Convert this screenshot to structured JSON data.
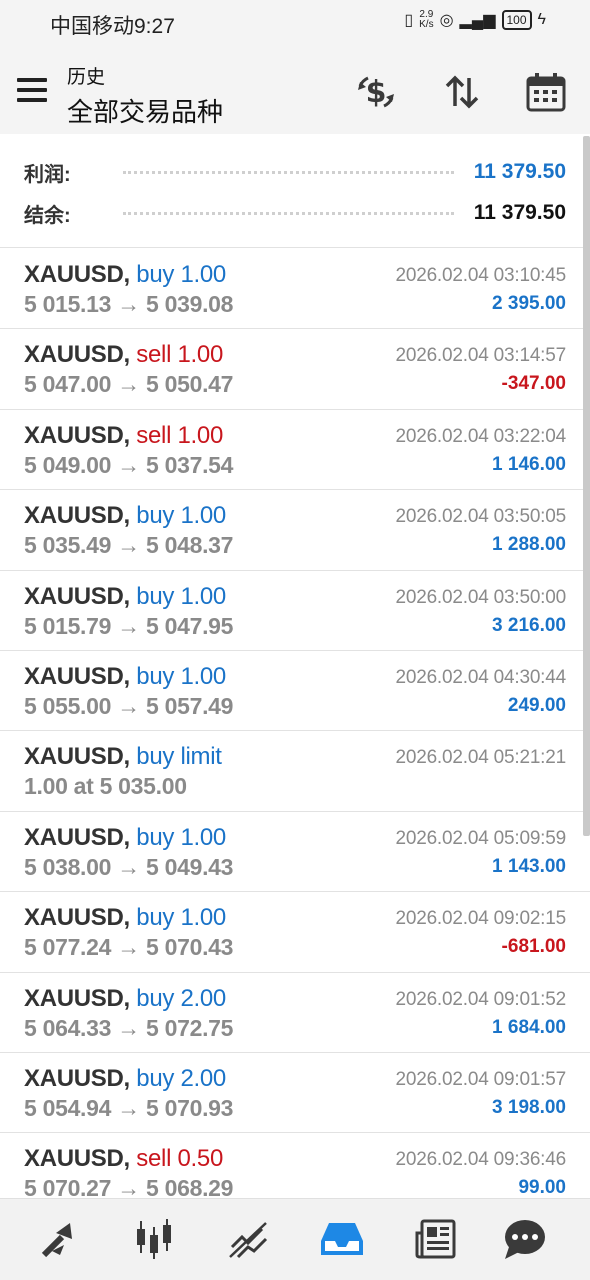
{
  "status_bar": {
    "carrier_time": "中国移动9:27",
    "speed_value": "2.9",
    "speed_unit": "K/s",
    "battery": "100"
  },
  "app_bar": {
    "subtitle": "历史",
    "title": "全部交易品种"
  },
  "summary": {
    "profit_label": "利润:",
    "profit_value": "11 379.50",
    "balance_label": "结余:",
    "balance_value": "11 379.50"
  },
  "trades": [
    {
      "symbol": "XAUUSD,",
      "type": "buy 1.00",
      "side": "buy",
      "prices": "5 015.13 → 5 039.08",
      "time": "2026.02.04 03:10:45",
      "profit": "2 395.00",
      "sign": "pos"
    },
    {
      "symbol": "XAUUSD,",
      "type": "sell 1.00",
      "side": "sell",
      "prices": "5 047.00 → 5 050.47",
      "time": "2026.02.04 03:14:57",
      "profit": "-347.00",
      "sign": "neg"
    },
    {
      "symbol": "XAUUSD,",
      "type": "sell 1.00",
      "side": "sell",
      "prices": "5 049.00 → 5 037.54",
      "time": "2026.02.04 03:22:04",
      "profit": "1 146.00",
      "sign": "pos"
    },
    {
      "symbol": "XAUUSD,",
      "type": "buy 1.00",
      "side": "buy",
      "prices": "5 035.49 → 5 048.37",
      "time": "2026.02.04 03:50:05",
      "profit": "1 288.00",
      "sign": "pos"
    },
    {
      "symbol": "XAUUSD,",
      "type": "buy 1.00",
      "side": "buy",
      "prices": "5 015.79 → 5 047.95",
      "time": "2026.02.04 03:50:00",
      "profit": "3 216.00",
      "sign": "pos"
    },
    {
      "symbol": "XAUUSD,",
      "type": "buy 1.00",
      "side": "buy",
      "prices": "5 055.00 → 5 057.49",
      "time": "2026.02.04 04:30:44",
      "profit": "249.00",
      "sign": "pos"
    },
    {
      "symbol": "XAUUSD,",
      "type": "buy limit",
      "side": "buy",
      "prices": "1.00 at 5 035.00",
      "time": "2026.02.04 05:21:21",
      "profit": "",
      "sign": "pos"
    },
    {
      "symbol": "XAUUSD,",
      "type": "buy 1.00",
      "side": "buy",
      "prices": "5 038.00 → 5 049.43",
      "time": "2026.02.04 05:09:59",
      "profit": "1 143.00",
      "sign": "pos"
    },
    {
      "symbol": "XAUUSD,",
      "type": "buy 1.00",
      "side": "buy",
      "prices": "5 077.24 → 5 070.43",
      "time": "2026.02.04 09:02:15",
      "profit": "-681.00",
      "sign": "neg"
    },
    {
      "symbol": "XAUUSD,",
      "type": "buy 2.00",
      "side": "buy",
      "prices": "5 064.33 → 5 072.75",
      "time": "2026.02.04 09:01:52",
      "profit": "1 684.00",
      "sign": "pos"
    },
    {
      "symbol": "XAUUSD,",
      "type": "buy 2.00",
      "side": "buy",
      "prices": "5 054.94 → 5 070.93",
      "time": "2026.02.04 09:01:57",
      "profit": "3 198.00",
      "sign": "pos"
    },
    {
      "symbol": "XAUUSD,",
      "type": "sell 0.50",
      "side": "sell",
      "prices": "5 070.27 → 5 068.29",
      "time": "2026.02.04 09:36:46",
      "profit": "99.00",
      "sign": "pos"
    }
  ],
  "colors": {
    "buy": "#1a73c8",
    "sell": "#c8161d",
    "accent": "#1e88e5",
    "icon": "#3a3a3a"
  },
  "bottom_nav": {
    "items": [
      "quotes-icon",
      "chart-icon",
      "trade-icon",
      "history-icon",
      "news-icon",
      "chat-icon"
    ],
    "active": "history-icon"
  }
}
